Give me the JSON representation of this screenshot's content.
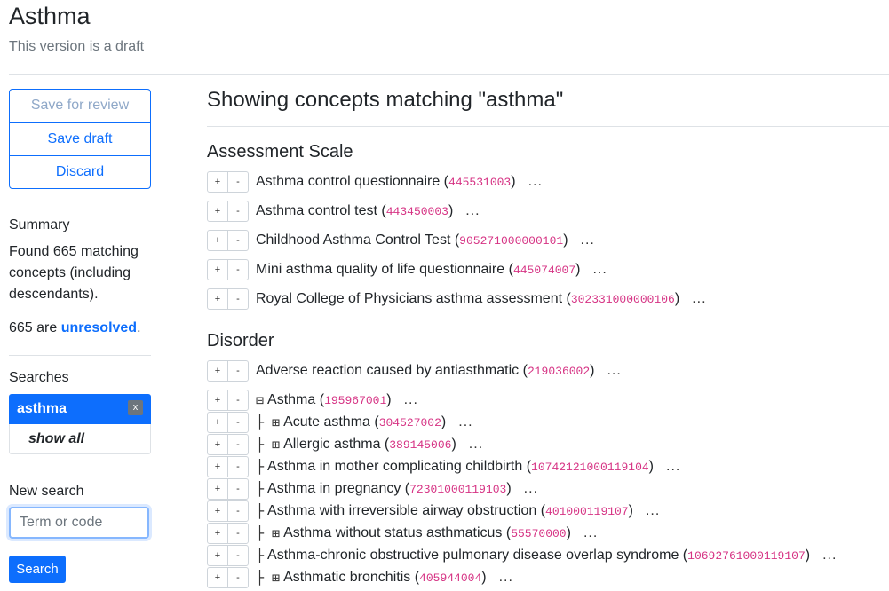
{
  "header": {
    "title": "Asthma",
    "subtitle": "This version is a draft"
  },
  "sidebar": {
    "buttons": {
      "save_review": "Save for review",
      "save_draft": "Save draft",
      "discard": "Discard"
    },
    "summary_heading": "Summary",
    "summary_text": "Found 665 matching concepts (including descendants).",
    "unresolved_count": "665 are",
    "unresolved_link": "unresolved",
    "unresolved_end": ".",
    "searches_heading": "Searches",
    "search_term": "asthma",
    "remove_label": "x",
    "show_all": "show all",
    "new_search_heading": "New search",
    "term_placeholder": "Term or code",
    "search_button": "Search"
  },
  "main": {
    "heading": "Showing concepts matching \"asthma\"",
    "sections": [
      {
        "title": "Assessment Scale"
      },
      {
        "title": "Disorder"
      }
    ],
    "plus": "+",
    "minus": "-",
    "ellipsis": "...",
    "rows": [
      {
        "prefix": "",
        "label": "Asthma control questionnaire",
        "code": "445531003"
      },
      {
        "prefix": "",
        "label": "Asthma control test",
        "code": "443450003"
      },
      {
        "prefix": "",
        "label": "Childhood Asthma Control Test",
        "code": "905271000000101"
      },
      {
        "prefix": "",
        "label": "Mini asthma quality of life questionnaire",
        "code": "445074007"
      },
      {
        "prefix": "",
        "label": "Royal College of Physicians asthma assessment",
        "code": "302331000000106"
      },
      {
        "prefix": "",
        "label": "Adverse reaction caused by antiasthmatic",
        "code": "219036002"
      },
      {
        "prefix": "⊟",
        "label": "Asthma",
        "code": "195967001"
      },
      {
        "prefix": "├ ⊞",
        "label": "Acute asthma",
        "code": "304527002"
      },
      {
        "prefix": "├ ⊞",
        "label": "Allergic asthma",
        "code": "389145006"
      },
      {
        "prefix": "├",
        "label": "Asthma in mother complicating childbirth",
        "code": "10742121000119104"
      },
      {
        "prefix": "├",
        "label": "Asthma in pregnancy",
        "code": "72301000119103"
      },
      {
        "prefix": "├",
        "label": "Asthma with irreversible airway obstruction",
        "code": "401000119107"
      },
      {
        "prefix": "├ ⊞",
        "label": "Asthma without status asthmaticus",
        "code": "55570000"
      },
      {
        "prefix": "├",
        "label": "Asthma-chronic obstructive pulmonary disease overlap syndrome",
        "code": "10692761000119107"
      },
      {
        "prefix": "├ ⊞",
        "label": "Asthmatic bronchitis",
        "code": "405944004"
      }
    ]
  }
}
